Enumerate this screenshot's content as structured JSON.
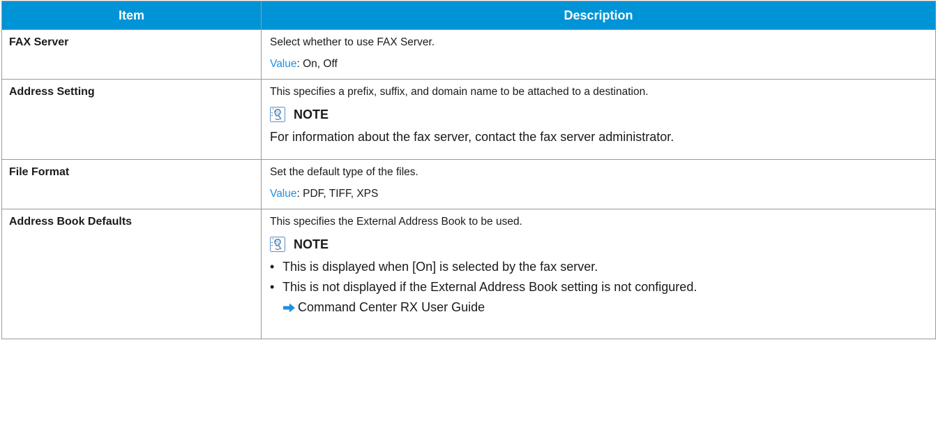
{
  "header": {
    "item": "Item",
    "description": "Description"
  },
  "rows": [
    {
      "item": "FAX Server",
      "description": "Select whether to use FAX Server.",
      "value_label": "Value",
      "value_text": ": On, Off"
    },
    {
      "item": "Address Setting",
      "description": "This specifies a prefix, suffix, and domain name to be attached to a destination.",
      "note_title": "NOTE",
      "note_icon": "note-icon",
      "note_text": "For information about the fax server, contact the fax server administrator."
    },
    {
      "item": "File Format",
      "description": "Set the default type of the files.",
      "value_label": "Value",
      "value_text": ": PDF, TIFF, XPS"
    },
    {
      "item": "Address Book Defaults",
      "description": "This specifies the External Address Book to be used.",
      "note_title": "NOTE",
      "note_icon": "note-icon",
      "bullets": [
        "This is displayed when [On] is selected by the fax server.",
        "This is not displayed if the External Address Book setting is not configured."
      ],
      "reference_icon": "arrow-right-icon",
      "reference": "Command Center RX User Guide"
    }
  ],
  "colors": {
    "header_bg": "#0093d6",
    "header_text": "#ffffff",
    "value_label": "#1f8fe0",
    "border": "#9a9a9a",
    "arrow": "#1f8fe0"
  }
}
